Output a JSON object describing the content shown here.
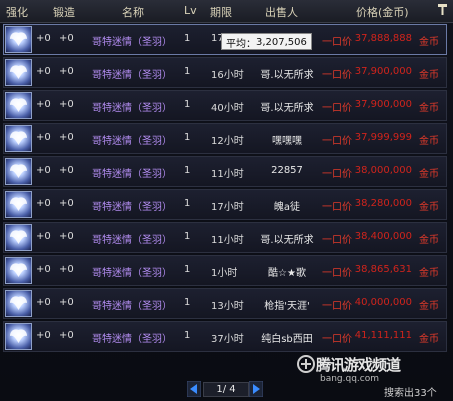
{
  "header": {
    "strengthen": "强化",
    "forge": "锻造",
    "name": "名称",
    "level": "Lv",
    "period": "期限",
    "seller": "出售人",
    "price": "价格(金币)",
    "sort_icon": "hammer-icon"
  },
  "rows": [
    {
      "strengthen": "+0",
      "forge": "+0",
      "name": "哥特迷情（圣羽）",
      "level": "1",
      "period": "17",
      "seller": "",
      "buyout": "一口价",
      "price": "37,888,888",
      "unit": "金币"
    },
    {
      "strengthen": "+0",
      "forge": "+0",
      "name": "哥特迷情（圣羽）",
      "level": "1",
      "period": "16小时",
      "seller": "哥.以无所求",
      "buyout": "一口价",
      "price": "37,900,000",
      "unit": "金币"
    },
    {
      "strengthen": "+0",
      "forge": "+0",
      "name": "哥特迷情（圣羽）",
      "level": "1",
      "period": "40小时",
      "seller": "哥.以无所求",
      "buyout": "一口价",
      "price": "37,900,000",
      "unit": "金币"
    },
    {
      "strengthen": "+0",
      "forge": "+0",
      "name": "哥特迷情（圣羽）",
      "level": "1",
      "period": "12小时",
      "seller": "嘿嘿嘿",
      "buyout": "一口价",
      "price": "37,999,999",
      "unit": "金币"
    },
    {
      "strengthen": "+0",
      "forge": "+0",
      "name": "哥特迷情（圣羽）",
      "level": "1",
      "period": "11小时",
      "seller": "22857",
      "buyout": "一口价",
      "price": "38,000,000",
      "unit": "金币"
    },
    {
      "strengthen": "+0",
      "forge": "+0",
      "name": "哥特迷情（圣羽）",
      "level": "1",
      "period": "17小时",
      "seller": "魄a徒",
      "buyout": "一口价",
      "price": "38,280,000",
      "unit": "金币"
    },
    {
      "strengthen": "+0",
      "forge": "+0",
      "name": "哥特迷情（圣羽）",
      "level": "1",
      "period": "11小时",
      "seller": "哥.以无所求",
      "buyout": "一口价",
      "price": "38,400,000",
      "unit": "金币"
    },
    {
      "strengthen": "+0",
      "forge": "+0",
      "name": "哥特迷情（圣羽）",
      "level": "1",
      "period": "1小时",
      "seller": "酷☆★歌",
      "buyout": "一口价",
      "price": "38,865,631",
      "unit": "金币"
    },
    {
      "strengthen": "+0",
      "forge": "+0",
      "name": "哥特迷情（圣羽）",
      "level": "1",
      "period": "13小时",
      "seller": "枪指'天涯'",
      "buyout": "一口价",
      "price": "40,000,000",
      "unit": "金币"
    },
    {
      "strengthen": "+0",
      "forge": "+0",
      "name": "哥特迷情（圣羽）",
      "level": "1",
      "period": "37小时",
      "seller": "纯白sb西田",
      "buyout": "一口价",
      "price": "41,111,111",
      "unit": "金币"
    }
  ],
  "tooltip": {
    "label": "平均：",
    "value": "3,207,506"
  },
  "pager": {
    "text": "1/ 4",
    "prev_icon": "triangle-left-icon",
    "next_icon": "triangle-right-icon"
  },
  "footer": {
    "total": "搜索出33个"
  },
  "watermark": {
    "title": "腾讯游戏频道",
    "site": "bang.qq.com"
  },
  "colors": {
    "price": "#d0241c",
    "name": "#b28cf0",
    "header_text": "#d9d2b8"
  }
}
